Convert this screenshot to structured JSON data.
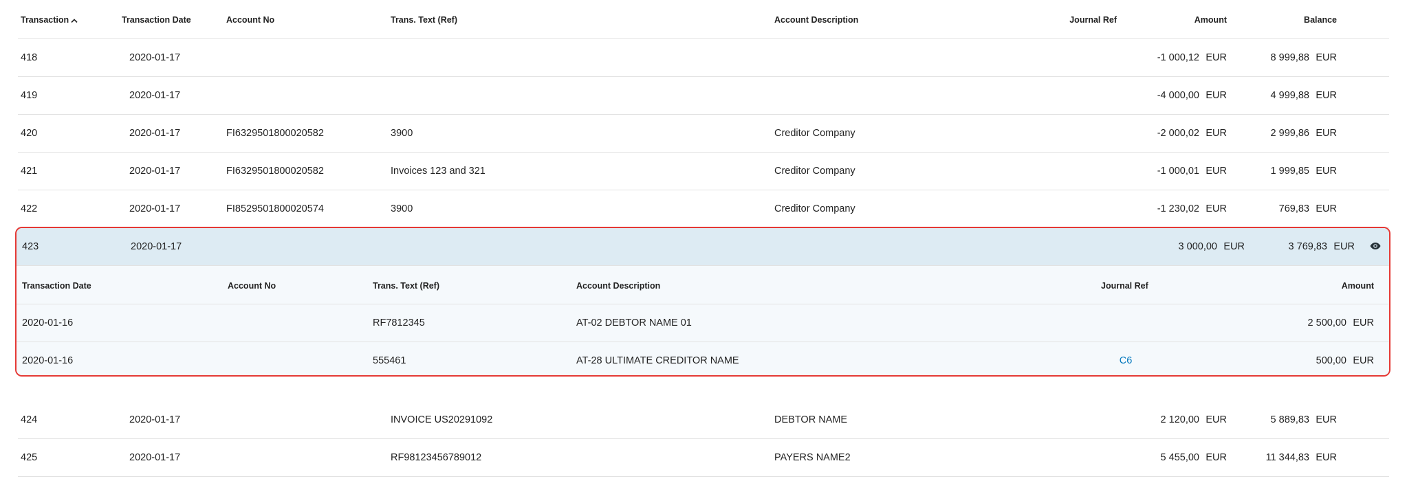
{
  "headers": {
    "transaction": "Transaction",
    "transaction_date": "Transaction Date",
    "account_no": "Account No",
    "trans_text": "Trans. Text (Ref)",
    "account_description": "Account Description",
    "journal_ref": "Journal Ref",
    "amount": "Amount",
    "balance": "Balance"
  },
  "rows": [
    {
      "tx": "418",
      "date": "2020-01-17",
      "account": "",
      "text": "",
      "desc": "",
      "jref": "",
      "amount": "-1 000,12",
      "amount_cur": "EUR",
      "balance": "8 999,88",
      "balance_cur": "EUR"
    },
    {
      "tx": "419",
      "date": "2020-01-17",
      "account": "",
      "text": "",
      "desc": "",
      "jref": "",
      "amount": "-4 000,00",
      "amount_cur": "EUR",
      "balance": "4 999,88",
      "balance_cur": "EUR"
    },
    {
      "tx": "420",
      "date": "2020-01-17",
      "account": "FI6329501800020582",
      "text": "3900",
      "desc": "Creditor Company",
      "jref": "",
      "amount": "-2 000,02",
      "amount_cur": "EUR",
      "balance": "2 999,86",
      "balance_cur": "EUR"
    },
    {
      "tx": "421",
      "date": "2020-01-17",
      "account": "FI6329501800020582",
      "text": "Invoices 123 and 321",
      "desc": "Creditor Company",
      "jref": "",
      "amount": "-1 000,01",
      "amount_cur": "EUR",
      "balance": "1 999,85",
      "balance_cur": "EUR"
    },
    {
      "tx": "422",
      "date": "2020-01-17",
      "account": "FI8529501800020574",
      "text": "3900",
      "desc": "Creditor Company",
      "jref": "",
      "amount": "-1 230,02",
      "amount_cur": "EUR",
      "balance": "769,83",
      "balance_cur": "EUR"
    }
  ],
  "expanded": {
    "tx": "423",
    "date": "2020-01-17",
    "amount": "3 000,00",
    "amount_cur": "EUR",
    "balance": "3 769,83",
    "balance_cur": "EUR",
    "eye_icon": "eye-icon",
    "sub_headers": {
      "transaction_date": "Transaction Date",
      "account_no": "Account No",
      "trans_text": "Trans. Text (Ref)",
      "account_description": "Account Description",
      "journal_ref": "Journal Ref",
      "amount": "Amount"
    },
    "sub_rows": [
      {
        "date": "2020-01-16",
        "account": "",
        "text": "RF7812345",
        "desc": "AT-02 DEBTOR NAME 01",
        "jref": "",
        "amount": "2 500,00",
        "cur": "EUR"
      },
      {
        "date": "2020-01-16",
        "account": "",
        "text": "555461",
        "desc": "AT-28 ULTIMATE CREDITOR NAME",
        "jref": "C6",
        "amount": "500,00",
        "cur": "EUR"
      }
    ]
  },
  "rows_after": [
    {
      "tx": "424",
      "date": "2020-01-17",
      "account": "",
      "text": "INVOICE US20291092",
      "desc": "DEBTOR NAME",
      "jref": "",
      "amount": "2 120,00",
      "amount_cur": "EUR",
      "balance": "5 889,83",
      "balance_cur": "EUR"
    },
    {
      "tx": "425",
      "date": "2020-01-17",
      "account": "",
      "text": "RF98123456789012",
      "desc": "PAYERS NAME2",
      "jref": "",
      "amount": "5 455,00",
      "amount_cur": "EUR",
      "balance": "11 344,83",
      "balance_cur": "EUR"
    }
  ],
  "colors": {
    "highlight": "#ddebf3",
    "border": "#e53935",
    "link": "#0277bd",
    "subrow_bg": "#f5f9fc"
  }
}
